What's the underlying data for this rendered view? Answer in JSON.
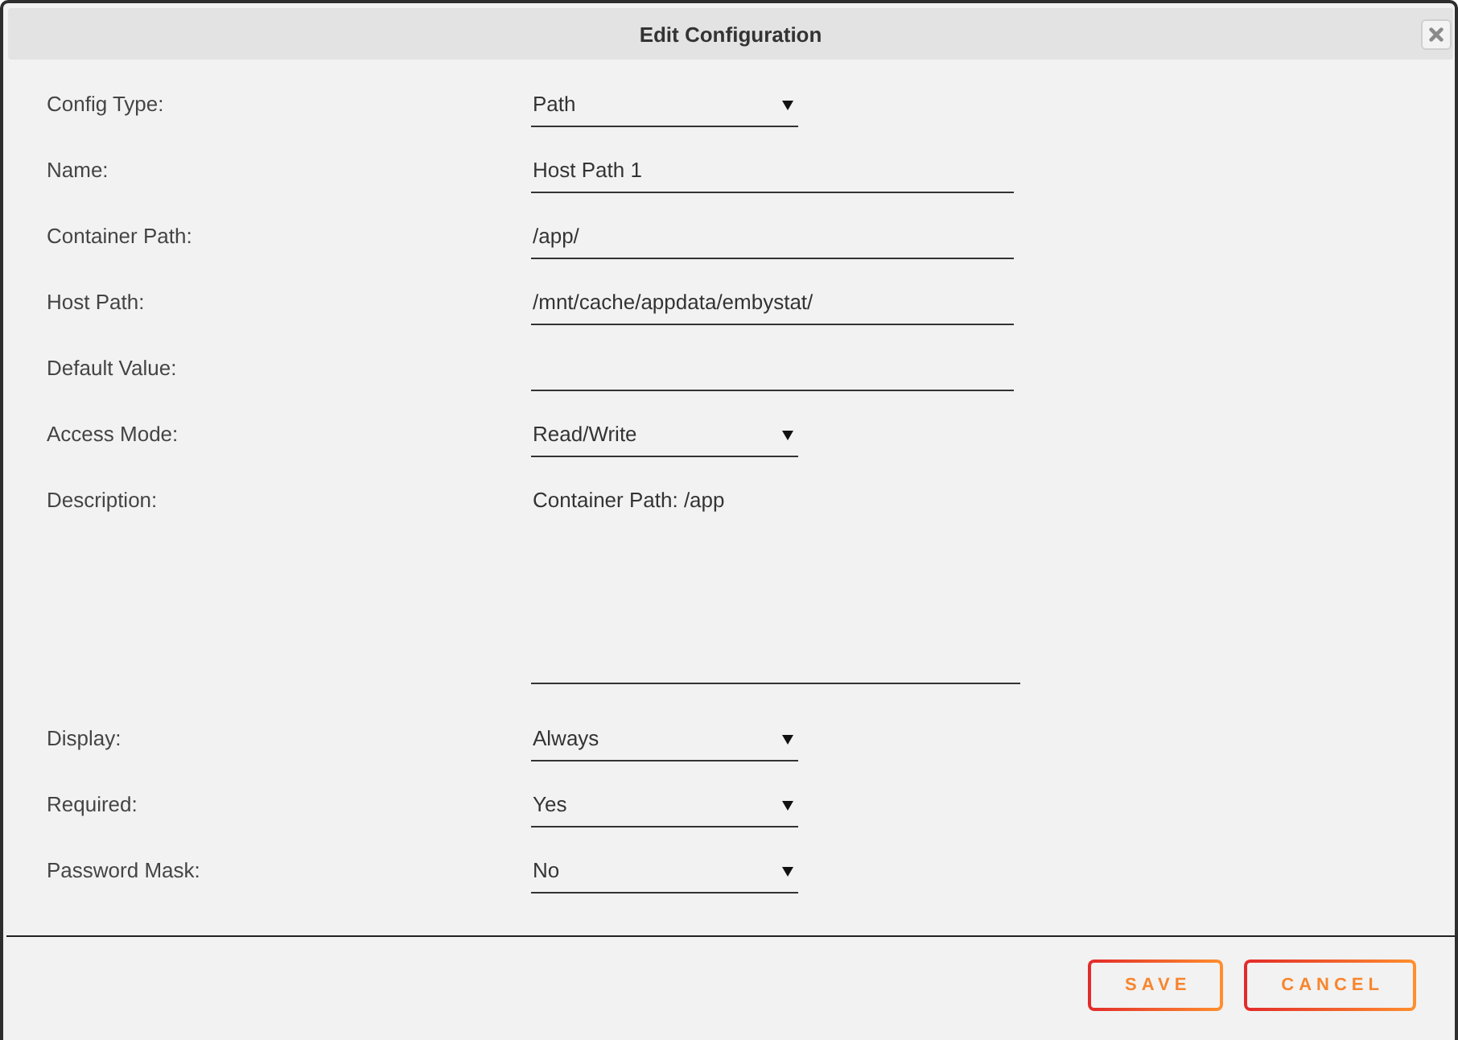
{
  "dialog": {
    "title": "Edit Configuration"
  },
  "fields": [
    {
      "label": "Config Type:",
      "kind": "select",
      "value": "Path"
    },
    {
      "label": "Name:",
      "kind": "text",
      "value": "Host Path 1"
    },
    {
      "label": "Container Path:",
      "kind": "text",
      "value": "/app/"
    },
    {
      "label": "Host Path:",
      "kind": "text",
      "value": "/mnt/cache/appdata/embystat/"
    },
    {
      "label": "Default Value:",
      "kind": "text"
    },
    {
      "label": "Access Mode:",
      "kind": "select",
      "value": "Read/Write"
    },
    {
      "label": "Description:",
      "kind": "textarea",
      "value": "Container Path: /app"
    },
    {
      "label": "Display:",
      "kind": "select",
      "value": "Always"
    },
    {
      "label": "Required:",
      "kind": "select",
      "value": "Yes"
    },
    {
      "label": "Password Mask:",
      "kind": "select",
      "value": "No"
    }
  ],
  "buttons": [
    "SAVE",
    "CANCEL"
  ]
}
